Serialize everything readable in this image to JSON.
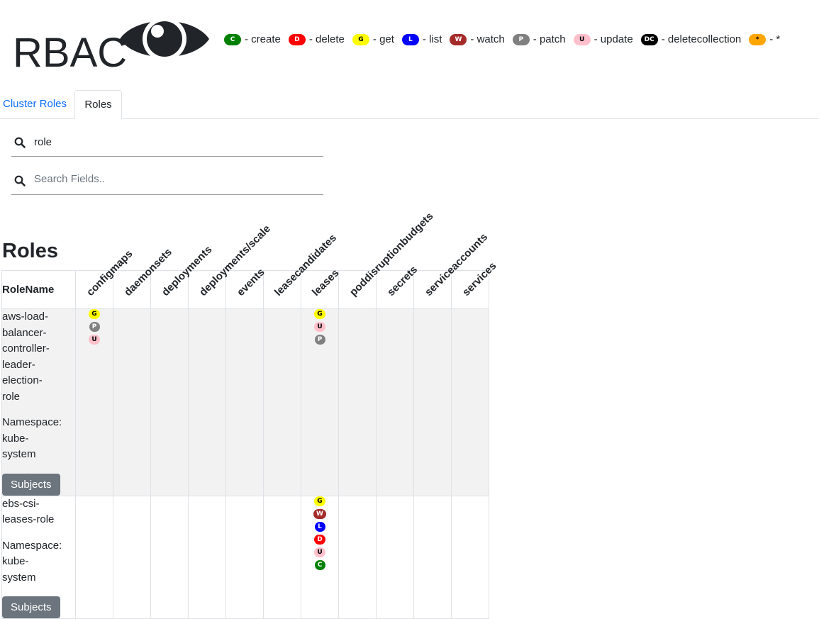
{
  "app": {
    "title": "RBAC",
    "logo_icon": "eye-icon"
  },
  "legend": [
    {
      "code": "C",
      "label": "- create",
      "bg": "#008000",
      "fg": "#ffffff"
    },
    {
      "code": "D",
      "label": "- delete",
      "bg": "#ff0000",
      "fg": "#ffffff"
    },
    {
      "code": "G",
      "label": "- get",
      "bg": "#ffff00",
      "fg": "#000000"
    },
    {
      "code": "L",
      "label": "- list",
      "bg": "#0000ff",
      "fg": "#ffffff"
    },
    {
      "code": "W",
      "label": "- watch",
      "bg": "#a52a2a",
      "fg": "#ffffff"
    },
    {
      "code": "P",
      "label": "- patch",
      "bg": "#808080",
      "fg": "#ffffff"
    },
    {
      "code": "U",
      "label": "- update",
      "bg": "#ffc0cb",
      "fg": "#000000"
    },
    {
      "code": "DC",
      "label": "- deletecollection",
      "bg": "#000000",
      "fg": "#ffffff"
    },
    {
      "code": "*",
      "label": "- *",
      "bg": "#ffa500",
      "fg": "#000000"
    }
  ],
  "tabs": {
    "cluster_roles": "Cluster Roles",
    "roles": "Roles",
    "active": "roles"
  },
  "search": {
    "role_value": "role",
    "fields_placeholder": "Search Fields.."
  },
  "section_heading": "Roles",
  "table": {
    "name_header": "RoleName",
    "columns": [
      "configmaps",
      "daemonsets",
      "deployments",
      "deployments/scale",
      "events",
      "leasecandidates",
      "leases",
      "poddisruptionbudgets",
      "secrets",
      "serviceaccounts",
      "services"
    ],
    "rows": [
      {
        "name_lines": [
          "aws-load-",
          "balancer-",
          "controller-",
          "leader-",
          "election-",
          "role"
        ],
        "namespace_lines": [
          "Namespace:",
          "kube-",
          "system"
        ],
        "button": "Subjects",
        "shaded": true,
        "cells": {
          "configmaps": [
            "G",
            "P",
            "U"
          ],
          "leases": [
            "G",
            "U",
            "P"
          ]
        }
      },
      {
        "name_lines": [
          "ebs-csi-",
          "leases-role"
        ],
        "namespace_lines": [
          "Namespace:",
          "kube-",
          "system"
        ],
        "button": "Subjects",
        "shaded": false,
        "cells": {
          "leases": [
            "G",
            "W",
            "L",
            "D",
            "U",
            "C"
          ]
        }
      }
    ]
  }
}
